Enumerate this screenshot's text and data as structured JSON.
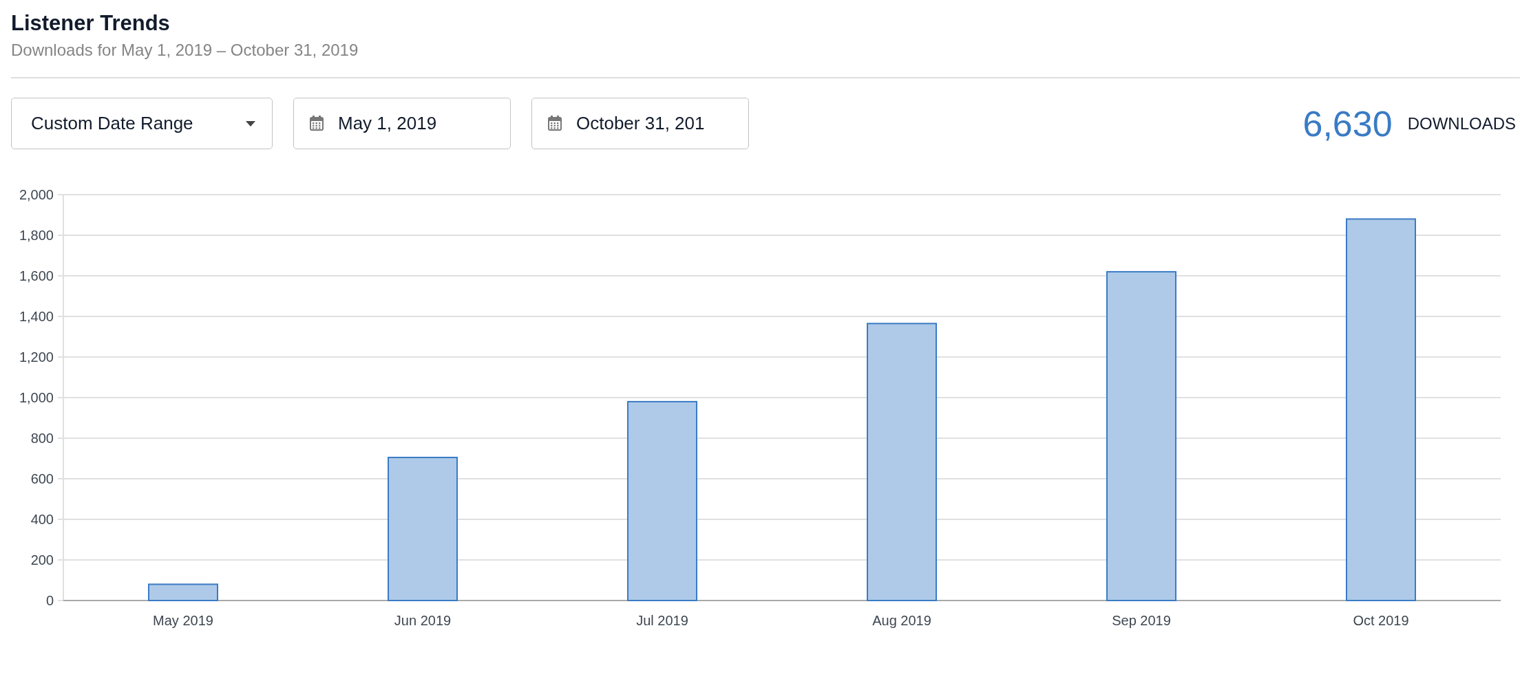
{
  "header": {
    "title": "Listener Trends",
    "subtitle": "Downloads for May 1, 2019 – October 31, 2019"
  },
  "controls": {
    "range_dropdown": {
      "value": "Custom Date Range"
    },
    "start_date": {
      "value": "May 1, 2019"
    },
    "end_date": {
      "value": "October 31, 201"
    }
  },
  "summary": {
    "total": "6,630",
    "label": "DOWNLOADS"
  },
  "chart_data": {
    "type": "bar",
    "categories": [
      "May 2019",
      "Jun 2019",
      "Jul 2019",
      "Aug 2019",
      "Sep 2019",
      "Oct 2019"
    ],
    "series": [
      {
        "color": "#aecae8",
        "values": [
          80,
          705,
          980,
          1365,
          1620,
          1880
        ]
      }
    ],
    "grid": true,
    "ylim": [
      0,
      2000
    ],
    "yticks": [
      {
        "value": 0,
        "label": "0"
      },
      {
        "value": 200,
        "label": "200"
      },
      {
        "value": 400,
        "label": "400"
      },
      {
        "value": 600,
        "label": "600"
      },
      {
        "value": 800,
        "label": "800"
      },
      {
        "value": 1000,
        "label": "1,000"
      },
      {
        "value": 1200,
        "label": "1,200"
      },
      {
        "value": 1400,
        "label": "1,400"
      },
      {
        "value": 1600,
        "label": "1,600"
      },
      {
        "value": 1800,
        "label": "1,800"
      },
      {
        "value": 2000,
        "label": "2,000"
      }
    ]
  }
}
